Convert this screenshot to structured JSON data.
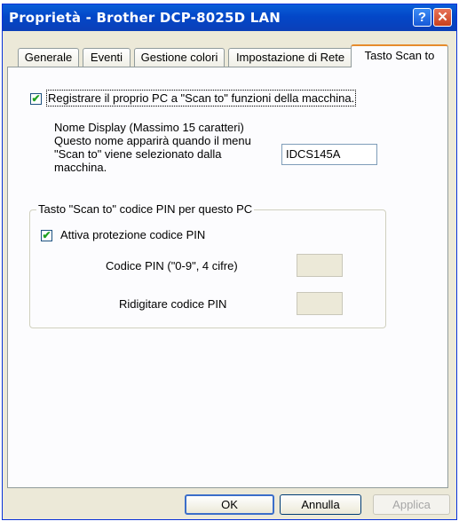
{
  "window": {
    "title": "Proprietà - Brother DCP-8025D LAN",
    "help_label": "?",
    "close_label": "✕"
  },
  "tabs": [
    {
      "label": "Generale"
    },
    {
      "label": "Eventi"
    },
    {
      "label": "Gestione colori"
    },
    {
      "label": "Impostazione di Rete"
    },
    {
      "label": "Tasto Scan to",
      "active": true
    }
  ],
  "panel": {
    "register_checkbox": {
      "label": "Registrare il proprio PC a \"Scan to\" funzioni della macchina.",
      "checked": true,
      "mark": "✔"
    },
    "display_name": {
      "line1": "Nome Display (Massimo 15 caratteri)",
      "line2": "Questo nome apparirà quando il menu",
      "line3": "\"Scan to\" viene selezionato dalla",
      "line4": "macchina.",
      "value": "IDCS145A"
    },
    "pin_group": {
      "title": "Tasto \"Scan to\" codice PIN per questo PC",
      "enable_checkbox": {
        "label": "Attiva protezione codice PIN",
        "checked": true,
        "mark": "✔"
      },
      "pin_label": "Codice PIN (\"0-9\", 4 cifre)",
      "pin_value": "",
      "confirm_label": "Ridigitare codice PIN",
      "confirm_value": ""
    }
  },
  "buttons": {
    "ok": "OK",
    "cancel": "Annulla",
    "apply": "Applica"
  }
}
